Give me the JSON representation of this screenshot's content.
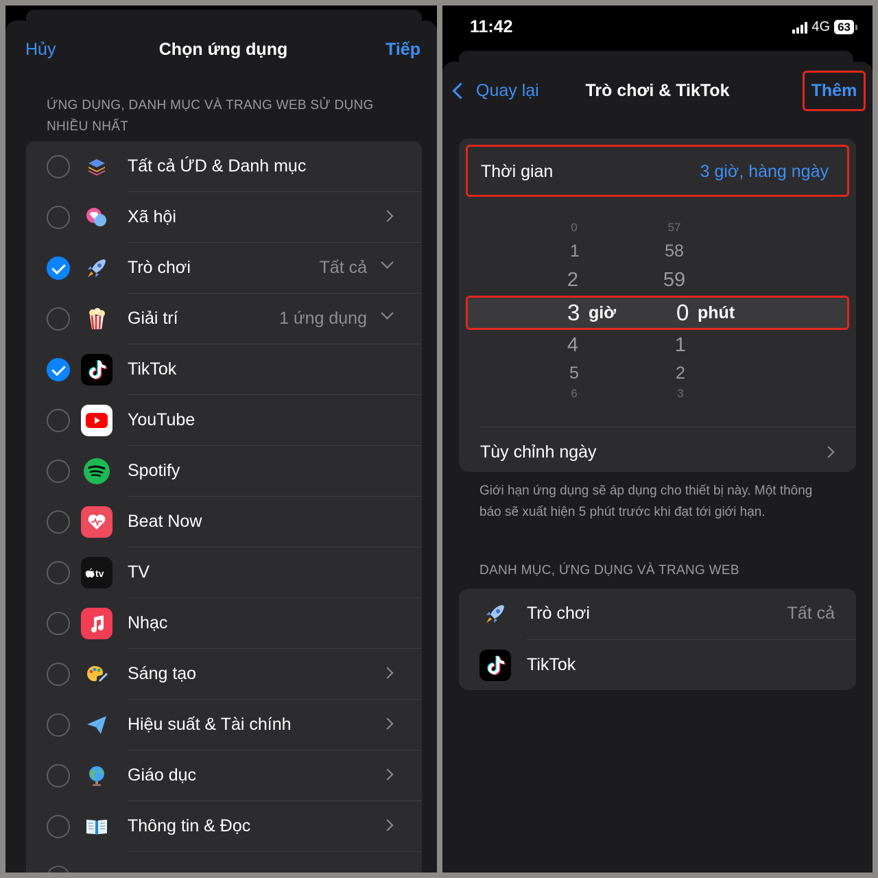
{
  "left": {
    "cancel_label": "Hủy",
    "title": "Chọn ứng dụng",
    "next_label": "Tiếp",
    "section_header": "ỨNG DỤNG, DANH MỤC VÀ TRANG WEB SỬ DỤNG NHIỀU NHẤT",
    "items": [
      {
        "label": "Tất cả ỨD & Danh mục",
        "detail": "",
        "checked": false,
        "icon": "stack-icon",
        "accessory": "none"
      },
      {
        "label": "Xã hội",
        "detail": "",
        "checked": false,
        "icon": "chat-bubbles-icon",
        "accessory": "chevron-right"
      },
      {
        "label": "Trò chơi",
        "detail": "Tất cả",
        "checked": true,
        "icon": "rocket-icon",
        "accessory": "chevron-down"
      },
      {
        "label": "Giải trí",
        "detail": "1 ứng dụng",
        "checked": false,
        "icon": "popcorn-icon",
        "accessory": "chevron-down"
      },
      {
        "label": "TikTok",
        "detail": "",
        "checked": true,
        "icon": "tiktok-icon",
        "accessory": "none"
      },
      {
        "label": "YouTube",
        "detail": "",
        "checked": false,
        "icon": "youtube-icon",
        "accessory": "none"
      },
      {
        "label": "Spotify",
        "detail": "",
        "checked": false,
        "icon": "spotify-icon",
        "accessory": "none"
      },
      {
        "label": "Beat Now",
        "detail": "",
        "checked": false,
        "icon": "beat-now-icon",
        "accessory": "none"
      },
      {
        "label": "TV",
        "detail": "",
        "checked": false,
        "icon": "apple-tv-icon",
        "accessory": "none"
      },
      {
        "label": "Nhạc",
        "detail": "",
        "checked": false,
        "icon": "music-icon",
        "accessory": "none"
      },
      {
        "label": "Sáng tạo",
        "detail": "",
        "checked": false,
        "icon": "palette-icon",
        "accessory": "chevron-right"
      },
      {
        "label": "Hiệu suất & Tài chính",
        "detail": "",
        "checked": false,
        "icon": "paper-plane-icon",
        "accessory": "chevron-right"
      },
      {
        "label": "Giáo dục",
        "detail": "",
        "checked": false,
        "icon": "globe-icon",
        "accessory": "chevron-right"
      },
      {
        "label": "Thông tin & Đọc",
        "detail": "",
        "checked": false,
        "icon": "book-icon",
        "accessory": "chevron-right"
      }
    ]
  },
  "right": {
    "status_time": "11:42",
    "network": "4G",
    "battery": "63",
    "back_label": "Quay lại",
    "title": "Trò chơi & TikTok",
    "add_label": "Thêm",
    "time_label": "Thời gian",
    "time_value": "3 giờ, hàng ngày",
    "picker": {
      "hours_above": [
        "0",
        "1",
        "2"
      ],
      "hours_selected": "3",
      "hours_unit": "giờ",
      "hours_below": [
        "4",
        "5",
        "6"
      ],
      "minutes_above": [
        "57",
        "58",
        "59"
      ],
      "minutes_selected": "0",
      "minutes_unit": "phút",
      "minutes_below": [
        "1",
        "2",
        "3"
      ]
    },
    "customize_label": "Tùy chỉnh ngày",
    "footnote": "Giới hạn ứng dụng sẽ áp dụng cho thiết bị này. Một thông báo sẽ xuất hiện 5 phút trước khi đạt tới giới hạn.",
    "section_header": "DANH MỤC, ỨNG DỤNG VÀ TRANG WEB",
    "selected_items": [
      {
        "label": "Trò chơi",
        "detail": "Tất cả",
        "icon": "rocket-icon"
      },
      {
        "label": "TikTok",
        "detail": "",
        "icon": "tiktok-icon"
      }
    ]
  },
  "colors": {
    "accent": "#3d8ff5",
    "highlight_box": "#e0271b",
    "card": "#2c2c2e",
    "sheet": "#1c1c1e"
  }
}
